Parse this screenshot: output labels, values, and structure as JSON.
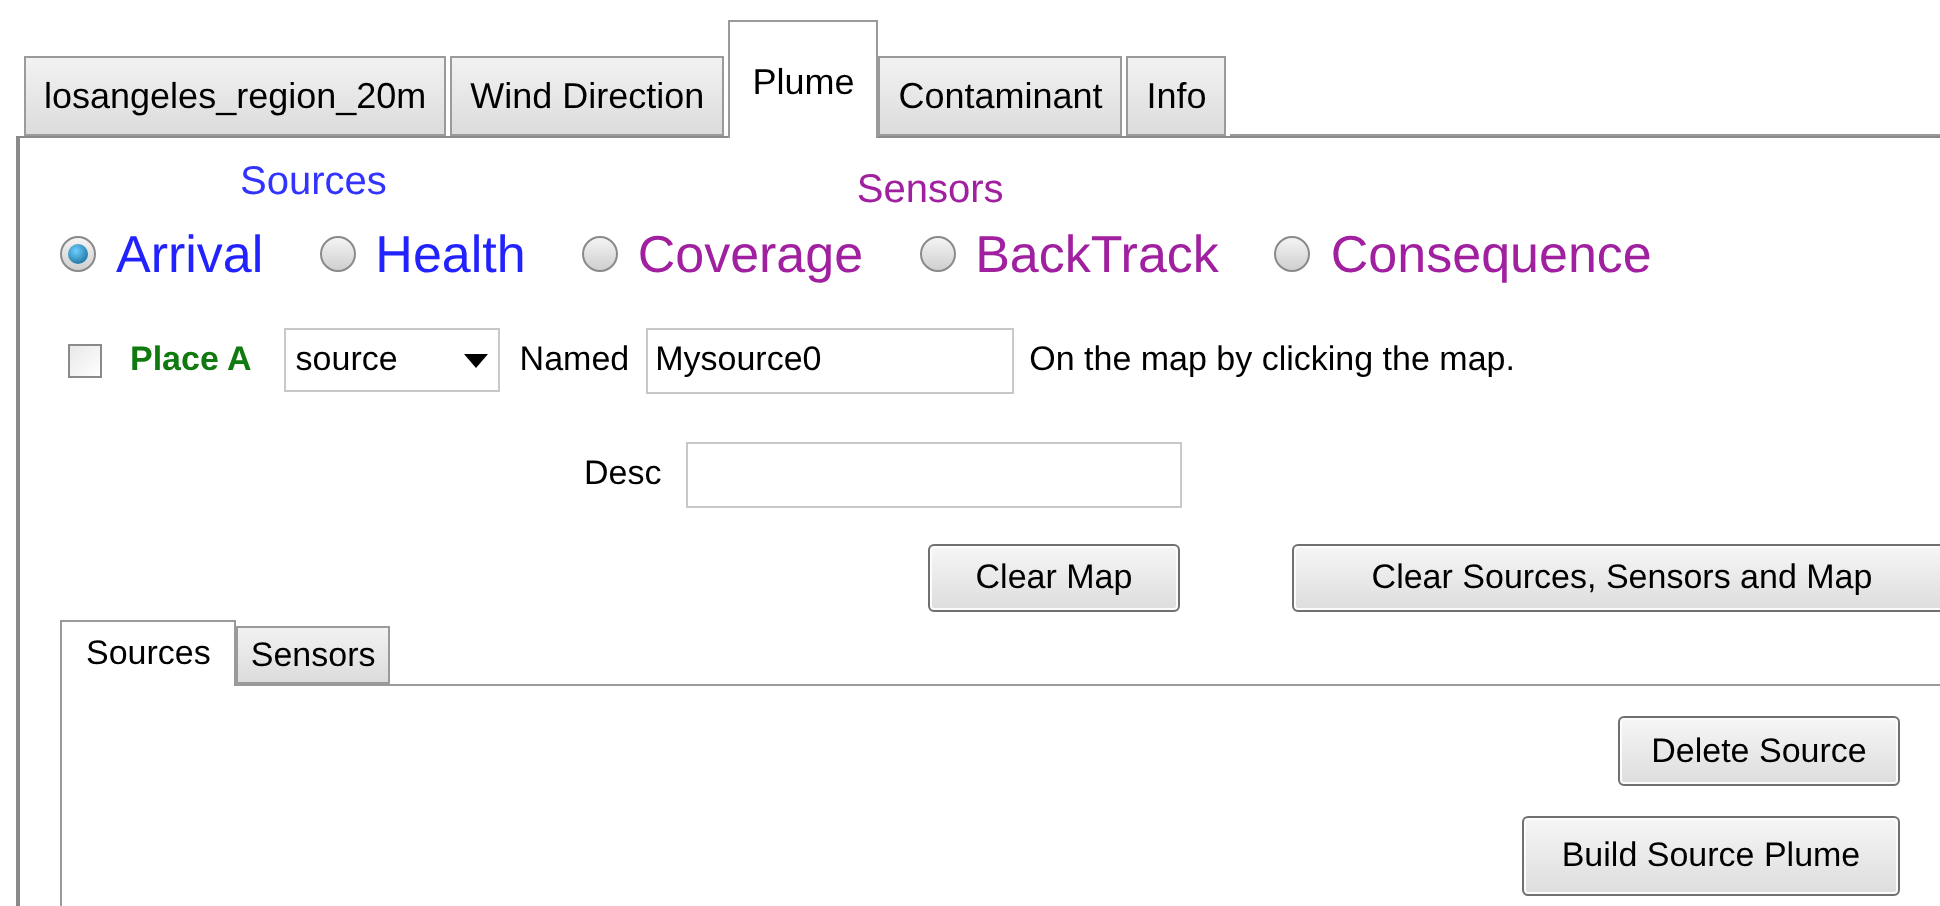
{
  "tabs": [
    {
      "label": "losangeles_region_20m",
      "selected": false
    },
    {
      "label": "Wind Direction",
      "selected": false
    },
    {
      "label": "Plume",
      "selected": true
    },
    {
      "label": "Contaminant",
      "selected": false
    },
    {
      "label": "Info",
      "selected": false
    }
  ],
  "group_labels": [
    {
      "label": "Sources",
      "color": "#3333ff"
    },
    {
      "label": "Sensors",
      "color": "#a020a0"
    }
  ],
  "modes": [
    {
      "label": "Arrival",
      "selected": true,
      "color": "#2222ff"
    },
    {
      "label": "Health",
      "selected": false,
      "color": "#2222ff"
    },
    {
      "label": "Coverage",
      "selected": false,
      "color": "#a020a0"
    },
    {
      "label": "BackTrack",
      "selected": false,
      "color": "#a020a0"
    },
    {
      "label": "Consequence",
      "selected": false,
      "color": "#a020a0"
    }
  ],
  "place": {
    "checked": false,
    "label": "Place A",
    "type_value": "source",
    "named_label": "Named",
    "name_value": "Mysource0",
    "hint": "On the map by clicking the map.",
    "desc_label": "Desc"
  },
  "buttons": [
    "Clear Map",
    "Clear Sources, Sensors and Map"
  ],
  "sub_tabs": [
    {
      "label": "Sources",
      "selected": true
    },
    {
      "label": "Sensors",
      "selected": false
    }
  ],
  "panel_buttons": [
    "Delete Source",
    "Build Source Plume"
  ]
}
